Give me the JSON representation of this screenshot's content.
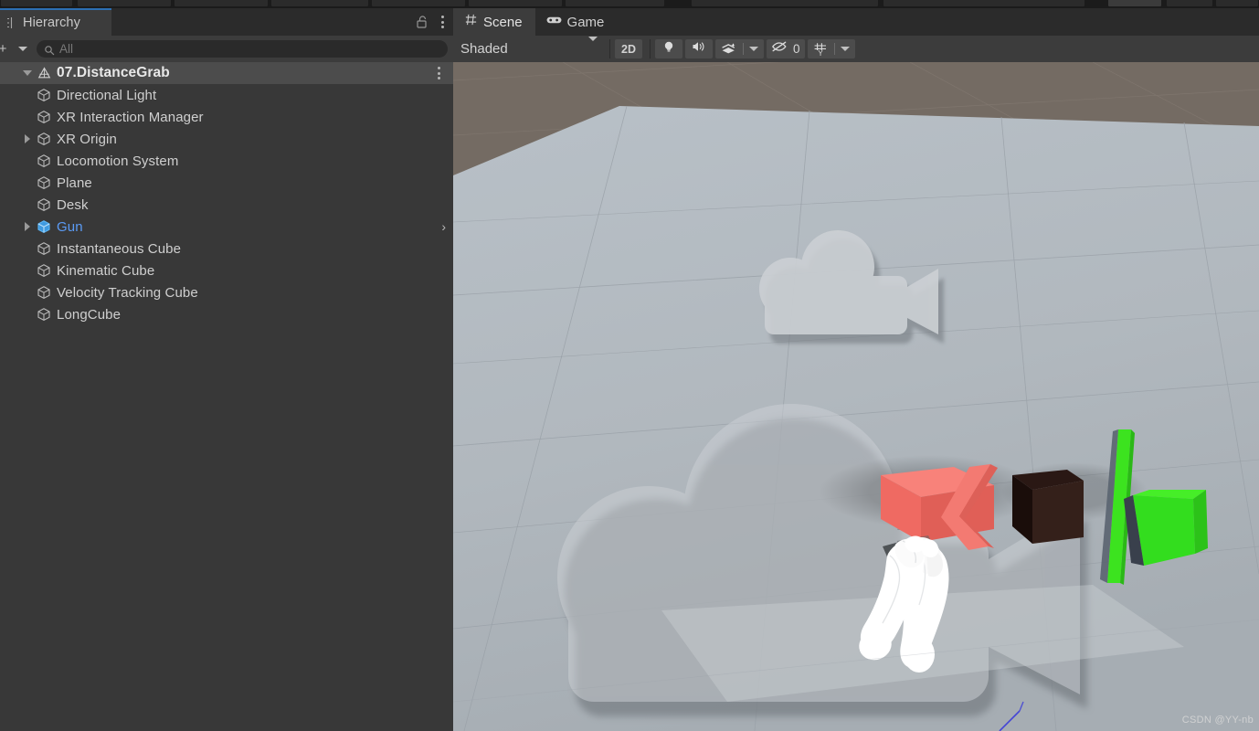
{
  "window": {
    "app": "Unity Editor",
    "top_toolbar_visible": true
  },
  "hierarchy": {
    "tab_label": "Hierarchy",
    "tab_icon": "hierarchy-icon",
    "lock_icon": "lock-open-icon",
    "menu_icon": "kebab-menu-icon",
    "add_button_label": "+",
    "add_caret_icon": "chevron-down-icon",
    "search": {
      "icon": "search-icon",
      "value": "",
      "placeholder": "All"
    },
    "scene_root": {
      "label": "07.DistanceGrab",
      "icon": "unity-scene-icon",
      "expanded": true,
      "menu_icon": "kebab-menu-icon"
    },
    "items": [
      {
        "label": "Directional Light",
        "icon": "gameobject-cube-icon",
        "expandable": false,
        "selected": false,
        "has_chevron": false
      },
      {
        "label": "XR Interaction Manager",
        "icon": "gameobject-cube-icon",
        "expandable": false,
        "selected": false,
        "has_chevron": false
      },
      {
        "label": "XR Origin",
        "icon": "gameobject-cube-icon",
        "expandable": true,
        "selected": false,
        "has_chevron": false
      },
      {
        "label": "Locomotion System",
        "icon": "gameobject-cube-icon",
        "expandable": false,
        "selected": false,
        "has_chevron": false
      },
      {
        "label": "Plane",
        "icon": "gameobject-cube-icon",
        "expandable": false,
        "selected": false,
        "has_chevron": false
      },
      {
        "label": "Desk",
        "icon": "gameobject-cube-icon",
        "expandable": false,
        "selected": false,
        "has_chevron": false
      },
      {
        "label": "Gun",
        "icon": "prefab-cube-icon",
        "expandable": true,
        "selected": true,
        "has_chevron": true
      },
      {
        "label": "Instantaneous Cube",
        "icon": "gameobject-cube-icon",
        "expandable": false,
        "selected": false,
        "has_chevron": false
      },
      {
        "label": "Kinematic Cube",
        "icon": "gameobject-cube-icon",
        "expandable": false,
        "selected": false,
        "has_chevron": false
      },
      {
        "label": "Velocity Tracking Cube",
        "icon": "gameobject-cube-icon",
        "expandable": false,
        "selected": false,
        "has_chevron": false
      },
      {
        "label": "LongCube",
        "icon": "gameobject-cube-icon",
        "expandable": false,
        "selected": false,
        "has_chevron": false
      }
    ]
  },
  "scene_view": {
    "tabs": [
      {
        "label": "Scene",
        "icon": "scene-grid-icon",
        "active": true
      },
      {
        "label": "Game",
        "icon": "gamepad-icon",
        "active": false
      }
    ],
    "toolbar": {
      "draw_mode": "Shaded",
      "draw_mode_caret": "chevron-down-icon",
      "toggle_2d": "2D",
      "lighting_icon": "lightbulb-icon",
      "audio_icon": "speaker-icon",
      "fx_icon": "effects-layers-icon",
      "fx_caret": "chevron-down-icon",
      "gizmos_icon": "gizmos-eye-off-icon",
      "gizmos_count": "0",
      "grid_icon": "grid-axis-y-icon",
      "grid_caret": "chevron-down-icon"
    },
    "watermark": "CSDN @YY-nb",
    "colors": {
      "sky": "#746b63",
      "ground_plane": "#b4bcc4",
      "red_cube": "#f0675f",
      "black_cube": "#1d0f0c",
      "green_cube": "#33dd1e",
      "hand": "#ffffff",
      "ray": "#3b3bd8",
      "selection_blue": "#5b9bf5"
    },
    "objects": [
      {
        "name": "instantaneous-cube",
        "color": "#f0675f",
        "shape": "cube"
      },
      {
        "name": "red-bent-piece",
        "color": "#f0675f",
        "shape": "bent-bar"
      },
      {
        "name": "kinematic-cube",
        "color": "#1d0f0c",
        "shape": "cube"
      },
      {
        "name": "long-cube",
        "color": "#33dd1e",
        "shape": "long-bar"
      },
      {
        "name": "velocity-tracking-cube",
        "color": "#33dd1e",
        "shape": "cube"
      },
      {
        "name": "vr-hand-left",
        "color": "#ffffff",
        "shape": "hand"
      },
      {
        "name": "vr-hand-right",
        "color": "#ffffff",
        "shape": "hand"
      },
      {
        "name": "camera-gizmo-small",
        "color": "#cfd2d5",
        "shape": "camera-icon"
      },
      {
        "name": "camera-gizmo-large",
        "color": "#cfd2d5",
        "shape": "camera-icon"
      }
    ]
  }
}
